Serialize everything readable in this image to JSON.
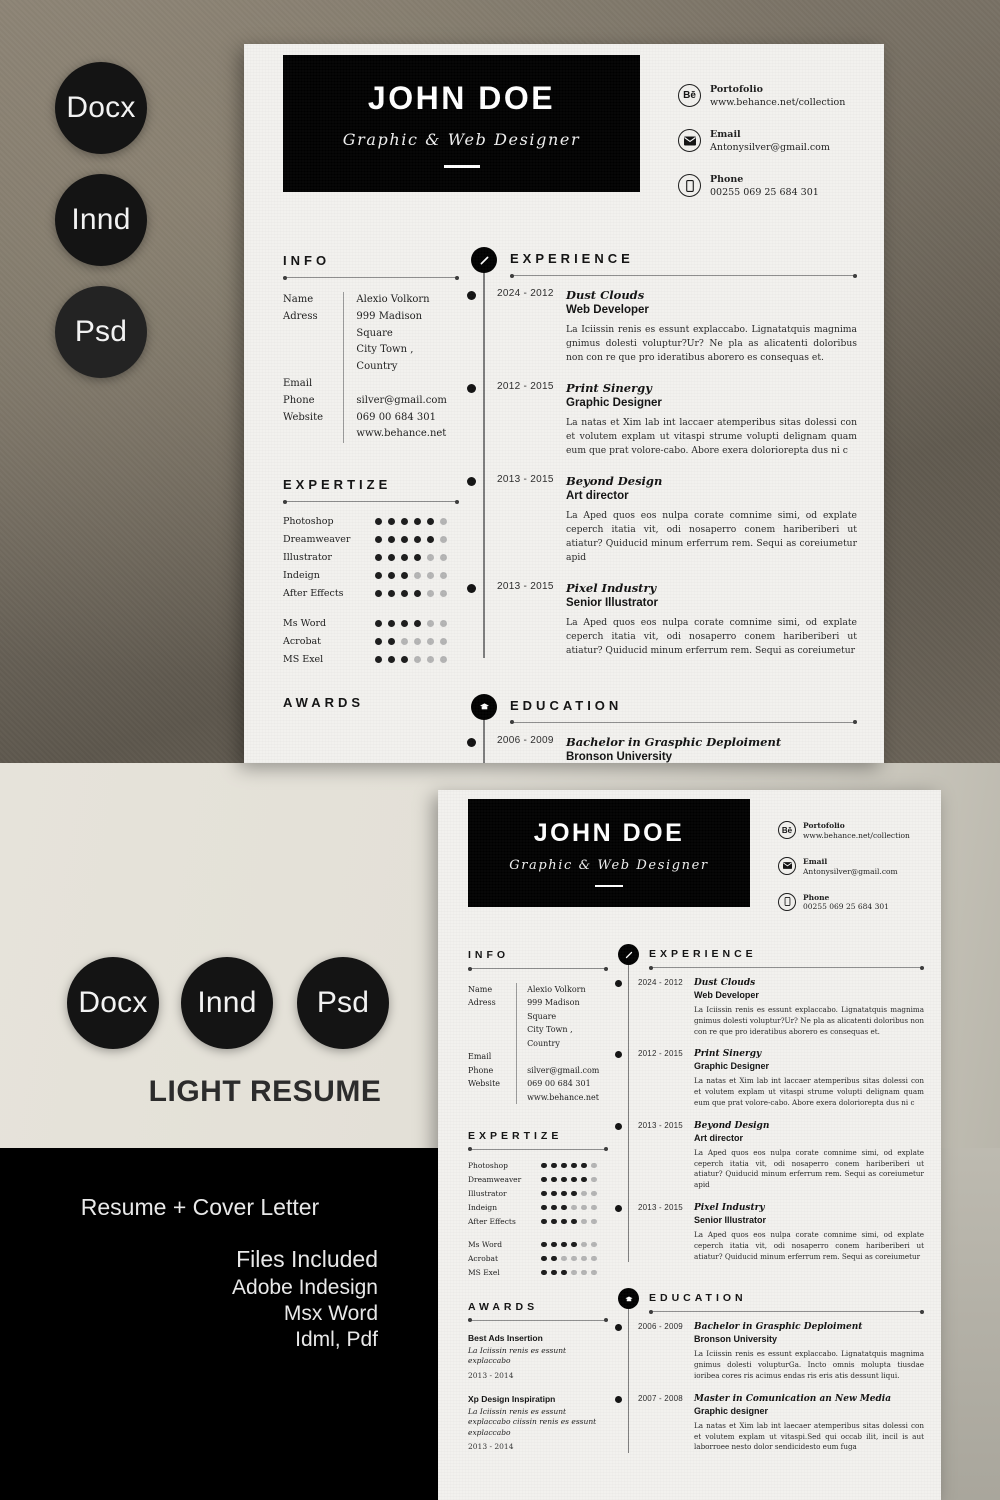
{
  "product": {
    "title": "LIGHT RESUME",
    "tagline": "Resume + Cover Letter",
    "files_included_label": "Files Included",
    "files": [
      "Adobe Indesign",
      "Msx Word",
      "Idml, Pdf"
    ],
    "format_badges": [
      "Docx",
      "Innd",
      "Psd"
    ]
  },
  "resume": {
    "header": {
      "name": "JOHN DOE",
      "role": "Graphic  &   Web  Designer"
    },
    "contacts": [
      {
        "icon": "behance-icon",
        "glyph": "Bē",
        "label": "Portofolio",
        "value": "www.behance.net/collection"
      },
      {
        "icon": "envelope-icon",
        "glyph": "envelope",
        "label": "Email",
        "value": "Antonysilver@gmail.com"
      },
      {
        "icon": "phone-icon",
        "glyph": "phone",
        "label": "Phone",
        "value": "00255 069 25 684 301"
      }
    ],
    "info": {
      "heading": "INFO",
      "keys_group1": [
        "Name",
        "Adress"
      ],
      "vals_group1": [
        "Alexio Volkorn",
        "999 Madison Square",
        "City Town ,",
        "Country"
      ],
      "keys_group2": [
        "Email",
        "Phone",
        "Website"
      ],
      "vals_group2": [
        "silver@gmail.com",
        "069 00 684 301",
        "www.behance.net"
      ]
    },
    "expertize": {
      "heading": "EXPERTIZE",
      "max": 6,
      "group1": [
        {
          "name": "Photoshop",
          "level": 5
        },
        {
          "name": "Dreamweaver",
          "level": 5
        },
        {
          "name": "Illustrator",
          "level": 4
        },
        {
          "name": "Indeign",
          "level": 3
        },
        {
          "name": "After Effects",
          "level": 4
        }
      ],
      "group2": [
        {
          "name": "Ms Word",
          "level": 4
        },
        {
          "name": "Acrobat",
          "level": 2
        },
        {
          "name": "MS Exel",
          "level": 3
        }
      ]
    },
    "awards": {
      "heading": "AWARDS",
      "items": [
        {
          "title": "Best Ads Insertion",
          "desc": "La Iciissin renis es essunt explaccabo",
          "date": "2013 - 2014"
        },
        {
          "title": "Xp Design Inspiratipn",
          "desc": "La Iciissin renis es essunt explaccabo ciissin renis es essunt explaccabo",
          "date": "2013 - 2014"
        }
      ]
    },
    "experience": {
      "heading": "EXPERIENCE",
      "icon": "pen-circle-icon",
      "items": [
        {
          "date": "2024 - 2012",
          "org": "Dust Clouds",
          "role": "Web Developer",
          "desc": "La Iciissin renis es essunt explaccabo. Lignatatquis magnima gnimus dolesti voluptur?Ur? Ne pla as alicatenti doloribus non con re que pro ideratibus aborero es consequas et."
        },
        {
          "date": "2012 - 2015",
          "org": "Print Sinergy",
          "role": "Graphic Designer",
          "desc": "La natas et Xim lab int laccaer atemperibus sitas dolessi con et volutem explam ut vitaspi strume volupti delignam quam eum que prat volore-cabo. Abore exera doloriorepta dus ni c"
        },
        {
          "date": "2013 - 2015",
          "org": "Beyond Design",
          "role": "Art director",
          "desc": "La Aped quos eos nulpa corate comnime simi, od explate ceperch itatia vit, odi nosaperro conem hariberiberi ut atiatur? Quiducid minum erferrum rem. Sequi as coreiumetur apid"
        },
        {
          "date": "2013 - 2015",
          "org": "Pixel Industry",
          "role": "Senior Illustrator",
          "desc": "La Aped quos eos nulpa corate comnime simi, od explate ceperch itatia vit, odi nosaperro conem hariberiberi ut atiatur? Quiducid minum erferrum rem. Sequi as coreiumetur"
        }
      ]
    },
    "education": {
      "heading": "EDUCATION",
      "icon": "graduation-cap-circle-icon",
      "items": [
        {
          "date": "2006 - 2009",
          "org": "Bachelor in Grasphic Deploiment",
          "role": "Bronson University",
          "desc": "La Iciissin renis es essunt explaccabo. Lignatatquis magnima gnimus dolesti volupturGa. Incto omnis molupta tiusdae ioribea cores ris acimus endas ris eris atis dessunt liqui."
        },
        {
          "date": "2007 - 2008",
          "org": "Master in Comunication an New Media",
          "role": "Graphic  designer",
          "desc": "La natas et Xim lab int laecaer atemperibus sitas dolessi con et volutem explam ut vitaspi.Sed qui occab ilit, incil is aut laborroee nesto dolor sendicidesto eum fuga"
        }
      ]
    }
  }
}
